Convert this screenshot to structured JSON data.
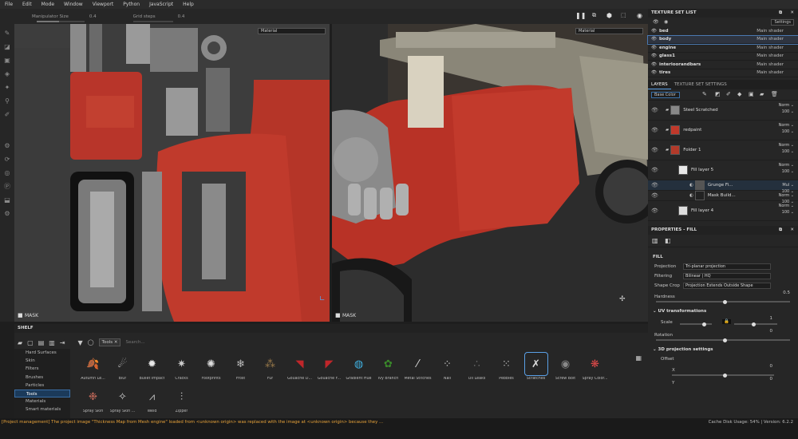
{
  "menu": [
    "File",
    "Edit",
    "Mode",
    "Window",
    "Viewport",
    "Python",
    "JavaScript",
    "Help"
  ],
  "toolbar": {
    "manip_label": "Manipulator Size",
    "manip_value": "0.4",
    "grid_label": "Grid steps",
    "grid_value": "0.4"
  },
  "viewport": {
    "left_channel": "Material",
    "right_channel": "Material",
    "left_mask_label": "MASK",
    "right_mask_label": "MASK"
  },
  "texture_set_list": {
    "title": "TEXTURE SET LIST",
    "settings_label": "Settings",
    "items": [
      {
        "name": "bed",
        "shader": "Main shader"
      },
      {
        "name": "body",
        "shader": "Main shader"
      },
      {
        "name": "engine",
        "shader": "Main shader"
      },
      {
        "name": "glass1",
        "shader": "Main shader"
      },
      {
        "name": "interioorandbars",
        "shader": "Main shader"
      },
      {
        "name": "tires",
        "shader": "Main shader"
      }
    ]
  },
  "layers": {
    "tab_layers": "LAYERS",
    "tab_settings": "TEXTURE SET SETTINGS",
    "channel": "Base Color",
    "items": [
      {
        "name": "Steel Scratched",
        "blend": "Norm",
        "opacity": "100"
      },
      {
        "name": "redpaint",
        "blend": "Norm",
        "opacity": "100"
      },
      {
        "name": "Folder 1",
        "blend": "Norm",
        "opacity": "100"
      },
      {
        "name": "Fill layer 5",
        "blend": "Norm",
        "opacity": "100"
      },
      {
        "name": "Grunge Fi...",
        "blend": "Mul",
        "opacity": "100"
      },
      {
        "name": "Mask Build...",
        "blend": "Norm",
        "opacity": "100"
      },
      {
        "name": "Fill layer 4",
        "blend": "Norm",
        "opacity": "100"
      }
    ]
  },
  "properties": {
    "title": "PROPERTIES - FILL",
    "section": "FILL",
    "projection_label": "Projection",
    "projection_value": "Tri-planar projection",
    "filtering_label": "Filtering",
    "filtering_value": "Bilinear | HQ",
    "shape_crop_label": "Shape Crop",
    "shape_crop_value": "Projection Extends Outside Shape",
    "hardness_label": "Hardness",
    "hardness_value": "0.5",
    "hardness_level": 0.5,
    "uv_title": "UV transformations",
    "scale_label": "Scale",
    "scale_value": "1",
    "rotation_label": "Rotation",
    "rotation_value": "0",
    "proj3d_title": "3D projection settings",
    "offset_label": "Offset",
    "x_label": "X",
    "x_value": "0",
    "y_label": "Y",
    "y_value": "0"
  },
  "shelf": {
    "title": "SHELF",
    "filter_tag": "Tools",
    "search_placeholder": "Search...",
    "categories": [
      "Hard Surfaces",
      "Skin",
      "Filters",
      "Brushes",
      "Particles",
      "Tools",
      "Materials",
      "Smart materials"
    ],
    "items": [
      {
        "label": "Autumn Le...",
        "icon": "leaf",
        "color": "#7a5a2a"
      },
      {
        "label": "Blur",
        "icon": "blur",
        "color": "#e0e0e0"
      },
      {
        "label": "Bullet Impact",
        "icon": "impact",
        "color": "#e8e8e8"
      },
      {
        "label": "Cracks",
        "icon": "cracks",
        "color": "#cccccc"
      },
      {
        "label": "Footprints",
        "icon": "footprints",
        "color": "#dddddd"
      },
      {
        "label": "Frost",
        "icon": "frost",
        "color": "#bbbbbb"
      },
      {
        "label": "Fur",
        "icon": "fur",
        "color": "#9a7a4a"
      },
      {
        "label": "Gouache D...",
        "icon": "gouache",
        "color": "#c0262a"
      },
      {
        "label": "Gouache F...",
        "icon": "gouache2",
        "color": "#c0262a"
      },
      {
        "label": "Gradient Hue",
        "icon": "gradient",
        "color": "#3fb0e0"
      },
      {
        "label": "Ivy Branch",
        "icon": "ivy",
        "color": "#3a8a2a"
      },
      {
        "label": "Metal Stitches",
        "icon": "stitches",
        "color": "#dddddd"
      },
      {
        "label": "Nail",
        "icon": "nail",
        "color": "#cccccc"
      },
      {
        "label": "Oil Leaks",
        "icon": "oil",
        "color": "#666666"
      },
      {
        "label": "Pebbles",
        "icon": "pebbles",
        "color": "#bbbbbb"
      },
      {
        "label": "Scratches",
        "icon": "scratches",
        "color": "#dddddd"
      },
      {
        "label": "Screw Bolt",
        "icon": "screw",
        "color": "#888888"
      },
      {
        "label": "Spray Color...",
        "icon": "spray",
        "color": "#e04a4a"
      },
      {
        "label": "Spray Skin",
        "icon": "sprayskin",
        "color": "#c46a5a"
      },
      {
        "label": "Spray Skin ...",
        "icon": "sprayskin2",
        "color": "#d0d0d0"
      },
      {
        "label": "Weld",
        "icon": "weld",
        "color": "#bbbbbb"
      },
      {
        "label": "Zipper",
        "icon": "zipper",
        "color": "#dddddd"
      }
    ]
  },
  "status": {
    "message": "[Project management] The project image \"Thickness Map from Mesh engine\" loaded from  <unknown origin> was replaced with the image at <unknown origin> because they ...",
    "cache": "Cache Disk Usage:   54%  |  Version: 6.2.2"
  },
  "colors": {
    "accent": "#3a6ea5",
    "warning": "#e8a33a",
    "red_paint": "#c0392b"
  }
}
